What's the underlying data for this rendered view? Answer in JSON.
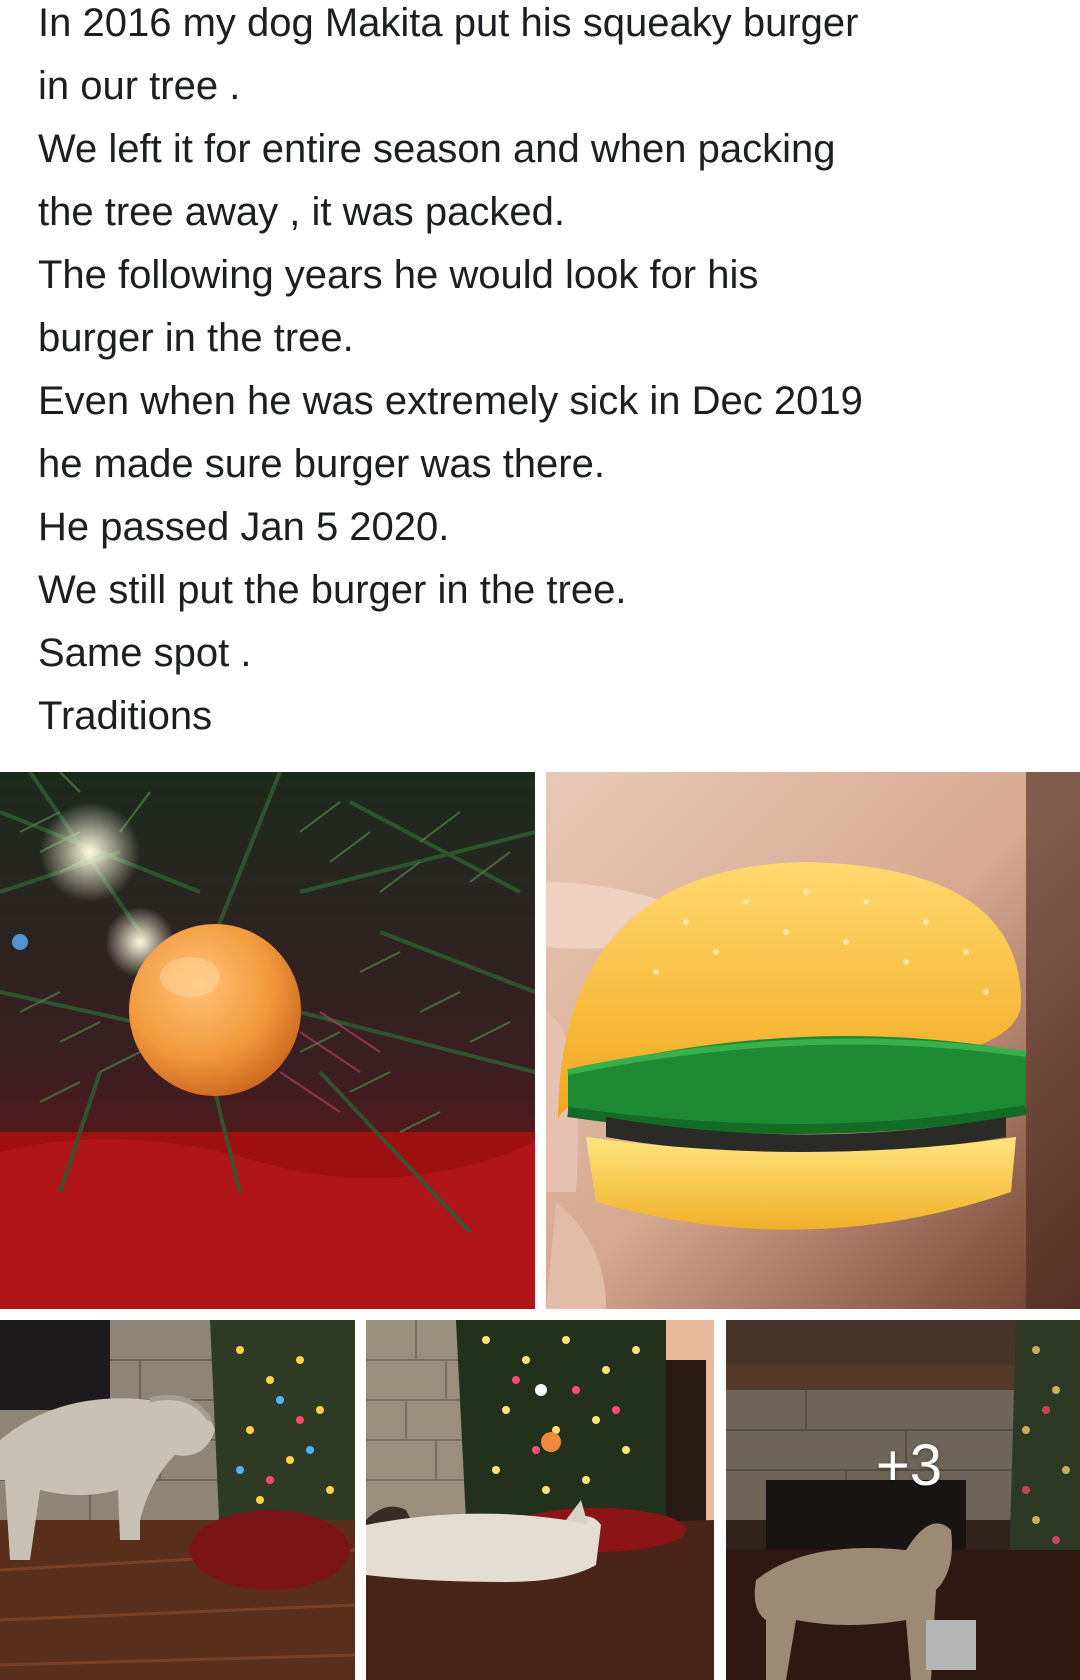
{
  "post": {
    "lines": [
      "In 2016 my dog Makita put his squeaky burger",
      "in our tree .",
      "We left it for entire season and when packing",
      "the tree away , it was packed.",
      "The following years he would look for his",
      "burger in the tree.",
      "Even when he was extremely sick in Dec 2019",
      "he made sure burger was there.",
      "He passed Jan 5 2020.",
      "We still put the burger in the tree.",
      "Same spot .",
      "Traditions"
    ]
  },
  "gallery": {
    "more_count": "+3"
  },
  "colors": {
    "text": "#1c1e21",
    "background": "#ffffff"
  }
}
